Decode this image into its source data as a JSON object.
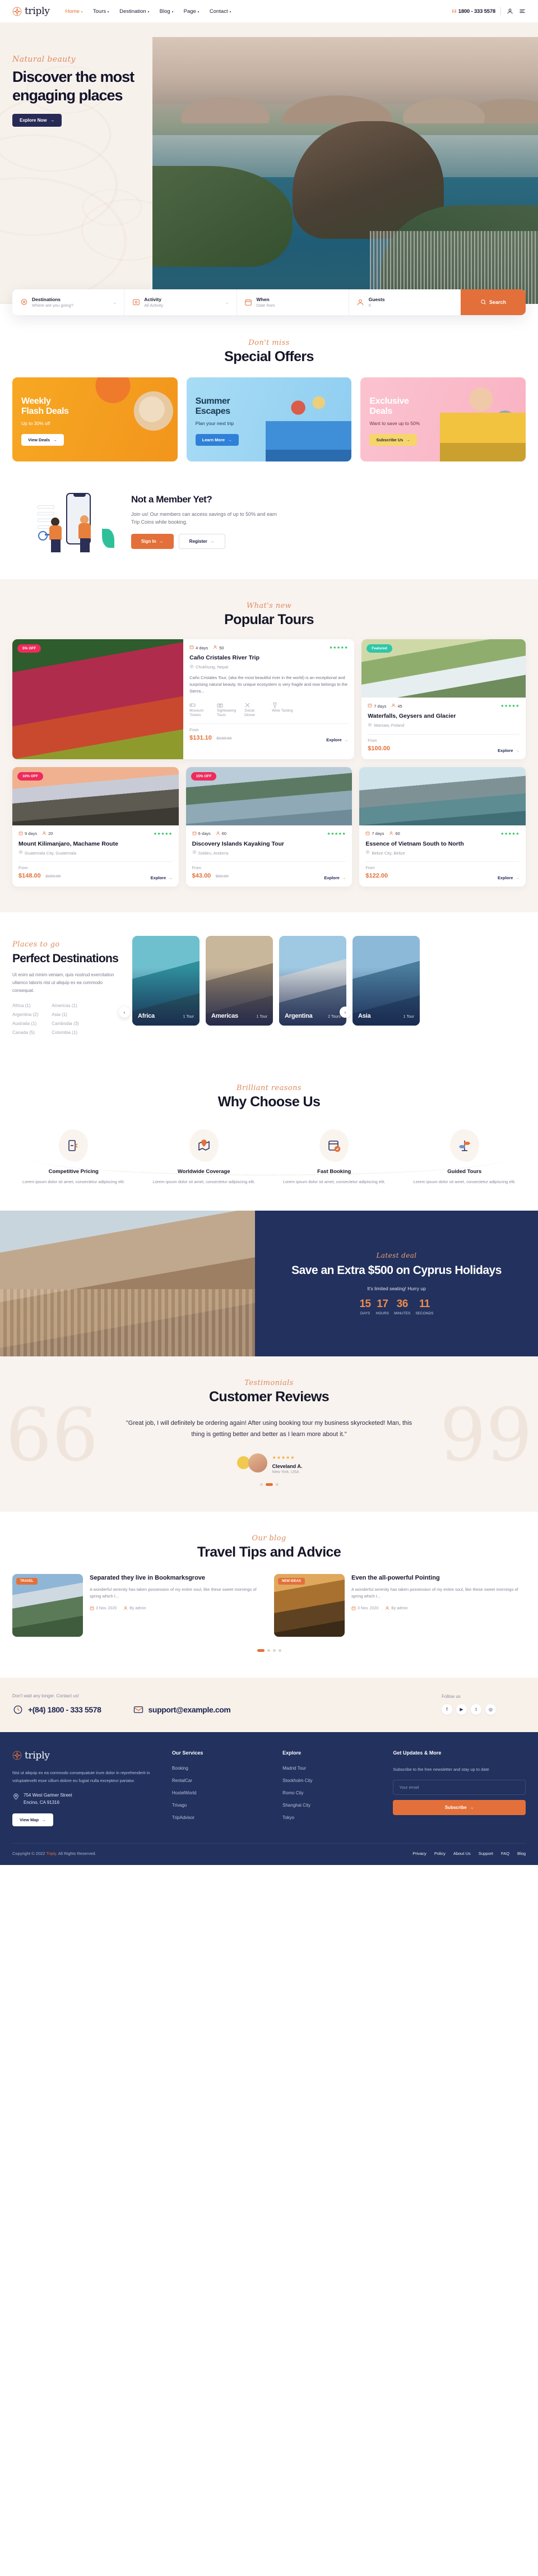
{
  "header": {
    "brand": "triply",
    "nav": [
      {
        "label": "Home",
        "active": true
      },
      {
        "label": "Tours",
        "active": false
      },
      {
        "label": "Destination",
        "active": false
      },
      {
        "label": "Blog",
        "active": false
      },
      {
        "label": "Page",
        "active": false
      },
      {
        "label": "Contact",
        "active": false
      }
    ],
    "phone": "1800 - 333 5578",
    "account_icon": "user-icon",
    "menu_icon": "hamburger-icon"
  },
  "hero": {
    "script": "Natural beauty",
    "title": "Discover the most engaging places",
    "cta": "Explore Now"
  },
  "search": {
    "fields": [
      {
        "icon": "location-pin-icon",
        "label": "Destinations",
        "sub": "Where are you going?",
        "chevron": true
      },
      {
        "icon": "activity-icon",
        "label": "Activity",
        "sub": "All Activity",
        "chevron": true
      },
      {
        "icon": "calendar-icon",
        "label": "When",
        "sub": "Date from",
        "chevron": false
      },
      {
        "icon": "user-icon",
        "label": "Guests",
        "sub": "0",
        "chevron": false
      }
    ],
    "button": "Search"
  },
  "offers": {
    "script": "Don't miss",
    "title": "Special Offers",
    "cards": [
      {
        "title": "Weekly\nFlash Deals",
        "sub": "Up to 30% off",
        "cta": "View Deals",
        "theme": "amber",
        "art": "art-hat"
      },
      {
        "title": "Summer\nEscapes",
        "sub": "Plan your next trip",
        "cta": "Learn More",
        "theme": "blue",
        "art": "art-car"
      },
      {
        "title": "Exclusive\nDeals",
        "sub": "Want to save up to 50%",
        "cta": "Subscribe Us",
        "theme": "pink",
        "art": "art-girl"
      }
    ]
  },
  "member": {
    "title": "Not a Member Yet?",
    "desc": "Join us! Our members can access savings of up to 50% and earn Trip Coins while booking.",
    "signin": "Sign In",
    "register": "Register"
  },
  "tours": {
    "script": "What's new",
    "title": "Popular Tours",
    "from_label": "From",
    "explore_label": "Explore",
    "featured": {
      "badge": "5% OFF",
      "days": "4 days",
      "people": "50",
      "stars": "★★★★★",
      "title": "Caño Cristales River Trip",
      "location": "Chukhung, Nepal",
      "desc": "Caño Cristales Tour, (aka the most beautiful river in the world) is an exceptional and surprising natural beauty. Its unique ecosystem is very fragile and now belongs to the Sierra...",
      "features": [
        {
          "icon": "ticket-icon",
          "label": "Museum Tickets"
        },
        {
          "icon": "camera-icon",
          "label": "Sightseeing Tours"
        },
        {
          "icon": "dinner-icon",
          "label": "Social Dinner"
        },
        {
          "icon": "wine-icon",
          "label": "Wine Tasting"
        }
      ],
      "price": "$131.10",
      "old_price": "$138.00"
    },
    "side": {
      "badge": "Featured",
      "days": "7 days",
      "people": "45",
      "stars": "★★★★★",
      "title": "Waterfalls, Geysers and Glacier",
      "location": "Warsaw, Poland",
      "price": "$100.00",
      "old_price": ""
    },
    "row": [
      {
        "badge": "10% OFF",
        "badge_type": "off",
        "days": "9 days",
        "people": "20",
        "stars": "★★★★★",
        "title": "Mount Kilimanjaro, Machame Route",
        "location": "Guatemala City, Guatemala",
        "price": "$148.00",
        "old_price": "$155.00",
        "img": "i-kili"
      },
      {
        "badge": "15% OFF",
        "badge_type": "off",
        "days": "6 days",
        "people": "60",
        "stars": "★★★★★",
        "title": "Discovery Islands Kayaking Tour",
        "location": "Soldeu, Andorra",
        "price": "$43.00",
        "old_price": "$50.00",
        "img": "i-kayak"
      },
      {
        "badge": "",
        "badge_type": "none",
        "days": "7 days",
        "people": "60",
        "stars": "★★★★★",
        "title": "Essence of Vietnam South to North",
        "location": "Belize City, Belize",
        "price": "$122.00",
        "old_price": "",
        "img": "i-halong"
      }
    ]
  },
  "destinations": {
    "script": "Places to go",
    "title": "Perfect Destinations",
    "desc": "Ut enim ad minim veniam, quis nostrud exercitation ullamco laboris nisi ut aliquip ex ea commodo consequat.",
    "list_left": [
      {
        "name": "Africa",
        "count": "(1)"
      },
      {
        "name": "Argentina",
        "count": "(2)"
      },
      {
        "name": "Australia",
        "count": "(1)"
      },
      {
        "name": "Canada",
        "count": "(5)"
      }
    ],
    "list_right": [
      {
        "name": "Americas",
        "count": "(1)"
      },
      {
        "name": "Asia",
        "count": "(1)"
      },
      {
        "name": "Cambodia",
        "count": "(3)"
      },
      {
        "name": "Colombia",
        "count": "(1)"
      }
    ],
    "cards": [
      {
        "name": "Africa",
        "count": "1 Tour",
        "cls": "d-africa"
      },
      {
        "name": "Americas",
        "count": "1 Tour",
        "cls": "d-americas"
      },
      {
        "name": "Argentina",
        "count": "2 Tours",
        "cls": "d-argentina"
      },
      {
        "name": "Asia",
        "count": "1 Tour",
        "cls": "d-asia"
      }
    ],
    "prev_icon": "chevron-left-icon",
    "next_icon": "chevron-right-icon"
  },
  "why": {
    "script": "Brilliant reasons",
    "title": "Why Choose Us",
    "items": [
      {
        "icon": "ticket-plane-icon",
        "title": "Competitive Pricing",
        "desc": "Lorem ipsum dolor sit amet, consectetur adipiscing elit."
      },
      {
        "icon": "map-pin-icon",
        "title": "Worldwide Coverage",
        "desc": "Lorem ipsum dolor sit amet, consectetur adipiscing elit."
      },
      {
        "icon": "calendar-check-icon",
        "title": "Fast Booking",
        "desc": "Lorem ipsum dolor sit amet, consectetur adipiscing elit."
      },
      {
        "icon": "signpost-icon",
        "title": "Guided Tours",
        "desc": "Lorem ipsum dolor sit amet, consectetur adipiscing elit."
      }
    ]
  },
  "deal": {
    "script": "Latest deal",
    "title": "Save an Extra $500 on Cyprus Holidays",
    "subtitle": "It's limited seating! Hurry up",
    "countdown": [
      {
        "value": "15",
        "label": "DAYS"
      },
      {
        "value": "17",
        "label": "HOURS"
      },
      {
        "value": "36",
        "label": "MINUTES"
      },
      {
        "value": "11",
        "label": "SECONDS"
      }
    ]
  },
  "reviews": {
    "script": "Testimonials",
    "title": "Customer Reviews",
    "quote": "\"Great job, I will definitely be ordering again! After using booking tour my business skyrocketed! Man, this thing is getting better and better as I learn more about it.\"",
    "stars": "★★★★★",
    "name": "Cleveland A.",
    "location": "New York, USA",
    "dots": 3,
    "active_dot": 1
  },
  "blog": {
    "script": "Our blog",
    "title": "Travel Tips and Advice",
    "posts": [
      {
        "tag": "TRAVEL",
        "img": "bi-mount",
        "title": "Separated they live in Bookmarksgrove",
        "desc": "A wonderful serenity has taken possession of my entire soul, like these sweet mornings of spring which I...",
        "date": "3 Nov, 2020",
        "author": "By admin"
      },
      {
        "tag": "NEW IDEAS",
        "img": "bi-forest",
        "title": "Even the all-powerful Pointing",
        "desc": "A wonderful serenity has taken possession of my entire soul, like these sweet mornings of spring which I...",
        "date": "3 Nov, 2020",
        "author": "By admin"
      }
    ],
    "dots": 4,
    "active_dot": 0
  },
  "contact": {
    "kicker": "Don't wait any longer. Contact us!",
    "phone": "+(84) 1800 - 333 5578",
    "email": "support@example.com",
    "follow_label": "Follow us",
    "socials": [
      "facebook-icon",
      "youtube-icon",
      "twitter-icon",
      "instagram-icon"
    ]
  },
  "footer": {
    "brand": "triply",
    "about": "Nisi ut aliquip ex ea commodo consequatute irure dolor in reprehenderit in voluptatevelit esse cillum dolore eu fugiat nulla  excepteur pariatur.",
    "address_line1": "754 West Gartner Street",
    "address_line2": "Encino, CA 91316",
    "map_btn": "View Map",
    "services_title": "Our Services",
    "services": [
      "Booking",
      "RentalCar",
      "HostelWorld",
      "Trivago",
      "TripAdvisor"
    ],
    "explore_title": "Explore",
    "explore": [
      "Madrid Tour",
      "Stockholm City",
      "Romo City",
      "Shanghai City",
      "Tokyo"
    ],
    "news_title": "Get Updates & More",
    "news_desc": "Subscribe to the free newsletter and stay up to date",
    "news_placeholder": "Your email",
    "subscribe": "Subscribe",
    "copyright_pre": "Copyright © 2022 ",
    "copyright_brand": "Triply",
    "copyright_post": ". All Rights Reserved.",
    "links": [
      "Privacy",
      "Policy",
      "About Us",
      "Support",
      "FAQ",
      "Blog"
    ]
  }
}
